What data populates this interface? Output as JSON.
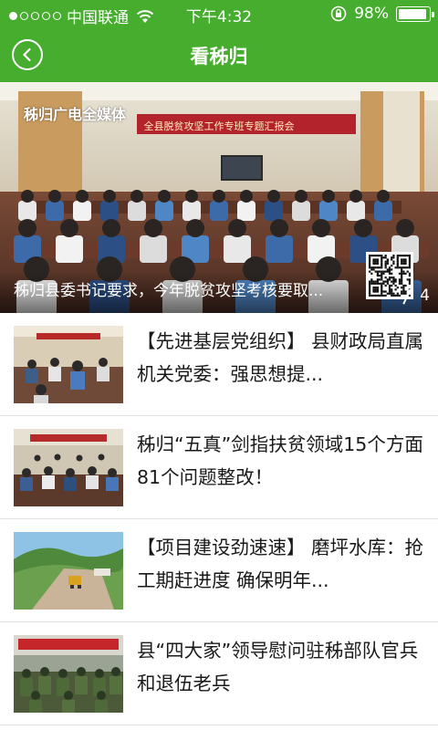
{
  "status_bar": {
    "carrier": "中国联通",
    "time": "下午4:32",
    "battery_text": "98%",
    "battery_level": 0.98,
    "signal_bars_filled": 1,
    "signal_bars_total": 5
  },
  "nav": {
    "title": "看秭归",
    "back_icon": "chevron-left-icon"
  },
  "hero": {
    "watermark": "秭归广电全媒体",
    "banner_text": "全县脱贫攻坚工作专班专题汇报会",
    "caption": "秭归县委书记要求，今年脱贫攻坚考核要取...",
    "page_count": "4"
  },
  "news": [
    {
      "title": "【先进基层党组织】 县财政局直属机关党委：强思想提..."
    },
    {
      "title": "秭归“五真”剑指扶贫领域15个方面81个问题整改！"
    },
    {
      "title": "【项目建设劲速速】 磨坪水库：抢工期赶进度 确保明年..."
    },
    {
      "title": "县“四大家”领导慰问驻秭部队官兵和退伍老兵"
    }
  ],
  "colors": {
    "brand_green": "#46ad2e",
    "text": "#1a1a1a",
    "divider": "#e2e2e2"
  }
}
